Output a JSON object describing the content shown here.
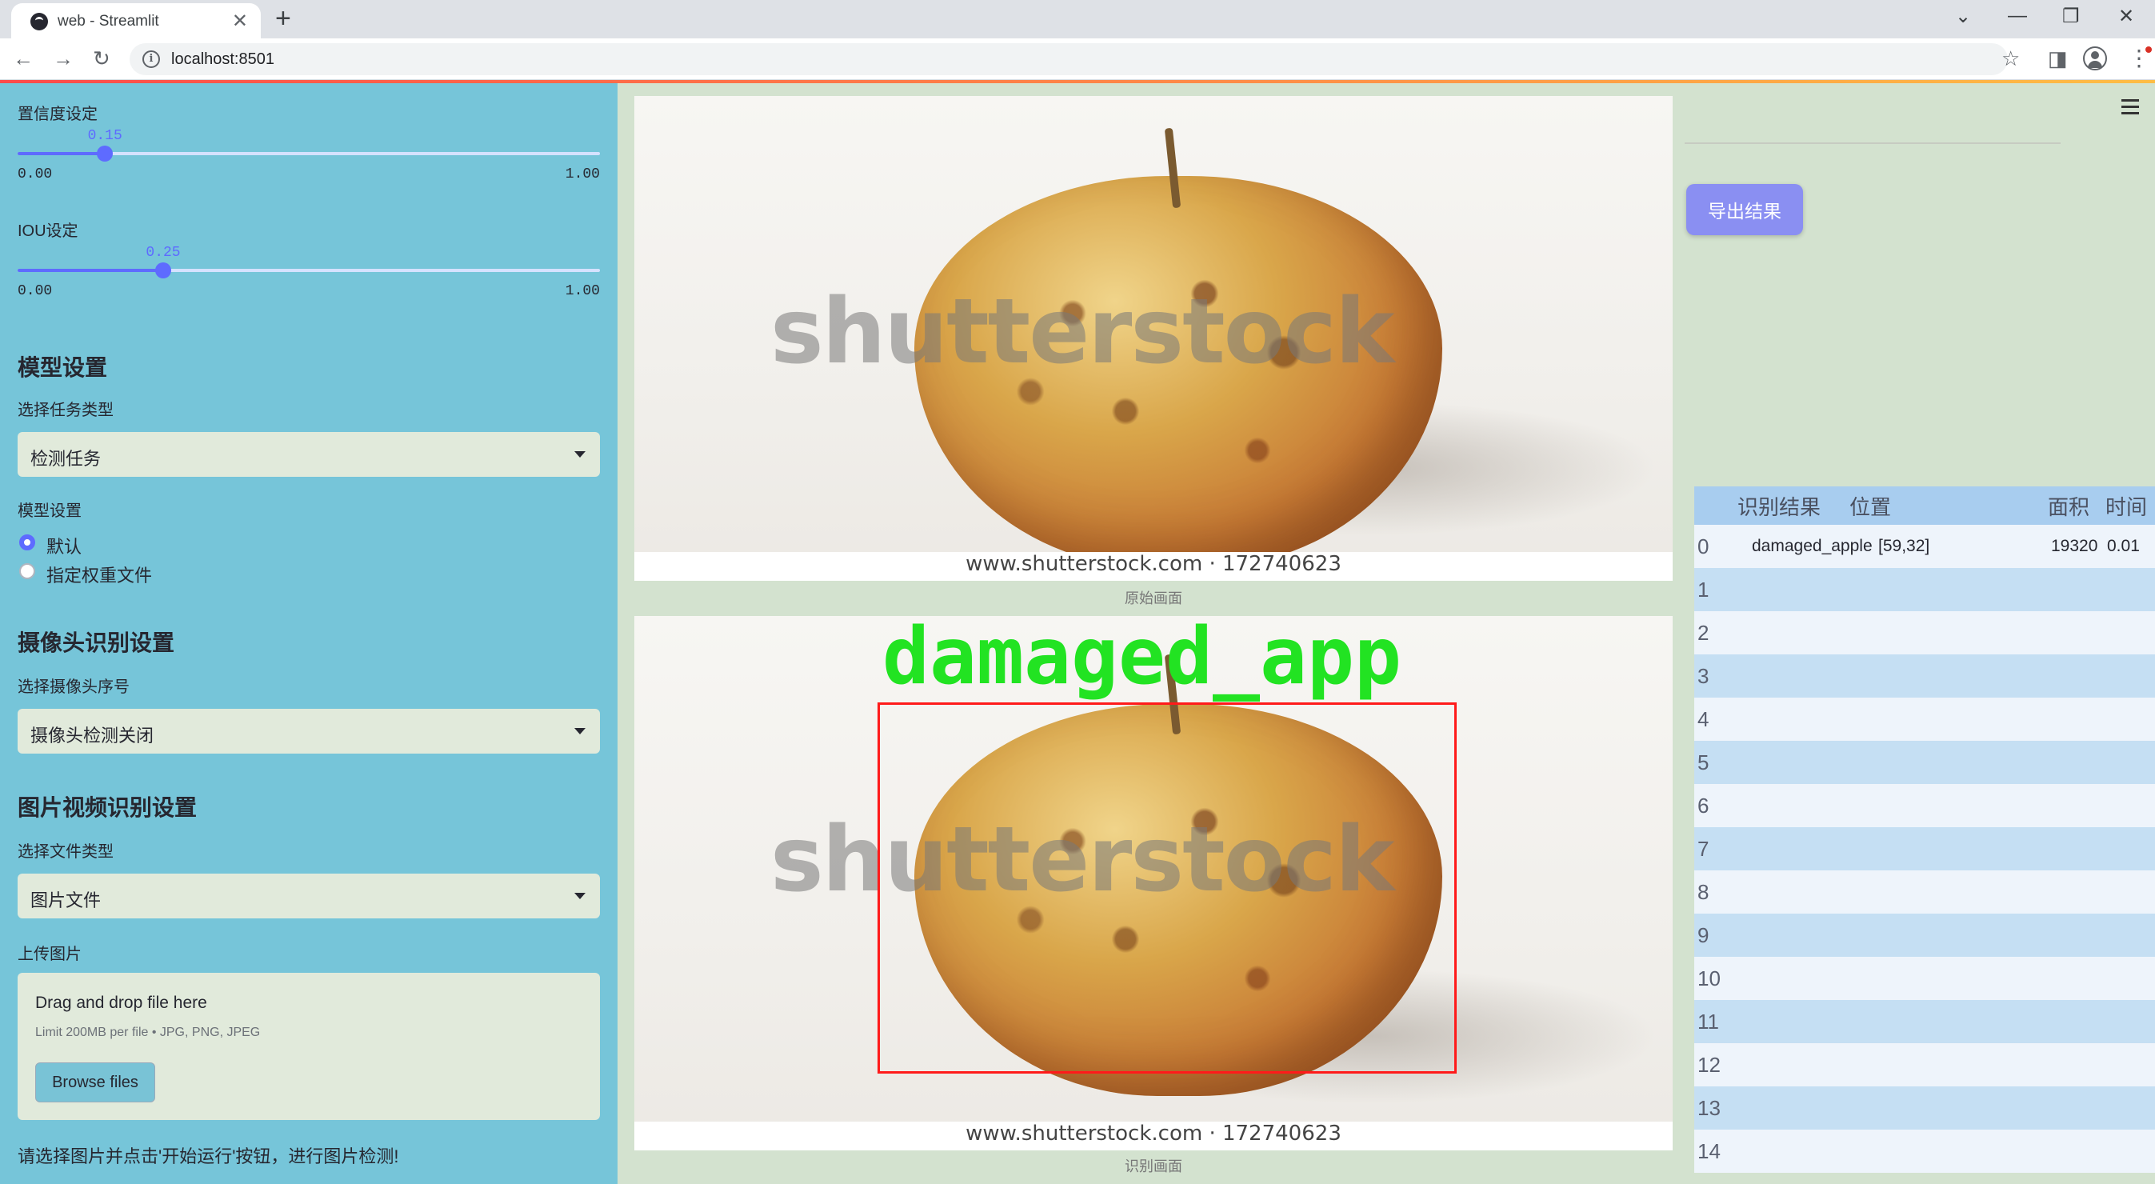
{
  "browser": {
    "tab_title": "web - Streamlit",
    "tab_close": "✕",
    "new_tab": "+",
    "url": "localhost:8501",
    "info": "i",
    "back": "←",
    "forward": "→",
    "reload": "↻",
    "bookmark": "☆",
    "sidepanel": "◨",
    "menu": "⋮",
    "win_dropdown": "⌄",
    "win_minimize": "—",
    "win_restore": "❐",
    "win_close": "✕"
  },
  "sidebar": {
    "confidence": {
      "label": "置信度设定",
      "value": "0.15",
      "min": "0.00",
      "max": "1.00",
      "fraction": 0.15
    },
    "iou": {
      "label": "IOU设定",
      "value": "0.25",
      "min": "0.00",
      "max": "1.00",
      "fraction": 0.25
    },
    "model_section": "模型设置",
    "task_type_label": "选择任务类型",
    "task_type_value": "检测任务",
    "model_setting_label": "模型设置",
    "model_options": [
      "默认",
      "指定权重文件"
    ],
    "model_selected": "默认",
    "camera_section": "摄像头识别设置",
    "camera_label": "选择摄像头序号",
    "camera_value": "摄像头检测关闭",
    "media_section": "图片视频识别设置",
    "file_type_label": "选择文件类型",
    "file_type_value": "图片文件",
    "upload_label": "上传图片",
    "upload_title": "Drag and drop file here",
    "upload_limit": "Limit 200MB per file • JPG, PNG, JPEG",
    "browse_label": "Browse files",
    "footer": "请选择图片并点击'开始运行'按钮，进行图片检测!"
  },
  "main": {
    "original_caption": "原始画面",
    "result_caption": "识别画面",
    "watermark": "shutterstock",
    "watermark_url": "www.shutterstock.com · 172740623",
    "detection_label": "damaged_app"
  },
  "right": {
    "export_label": "导出结果",
    "table": {
      "columns": [
        "识别结果",
        "位置",
        "面积",
        "时间"
      ],
      "rows": [
        {
          "index": "0",
          "result": "damaged_apple",
          "position": "[59,32]",
          "area": "19320",
          "time": "0.01"
        },
        {
          "index": "1"
        },
        {
          "index": "2"
        },
        {
          "index": "3"
        },
        {
          "index": "4"
        },
        {
          "index": "5"
        },
        {
          "index": "6"
        },
        {
          "index": "7"
        },
        {
          "index": "8"
        },
        {
          "index": "9"
        },
        {
          "index": "10"
        },
        {
          "index": "11"
        },
        {
          "index": "12"
        },
        {
          "index": "13"
        },
        {
          "index": "14"
        }
      ]
    }
  },
  "colors": {
    "sidebar_bg": "#76c5d9",
    "main_bg": "#d3e2cf",
    "accent": "#5e6bff",
    "export_button": "#8a8ff2",
    "detection_text": "#22e322",
    "detection_box": "#ff1a1a"
  }
}
